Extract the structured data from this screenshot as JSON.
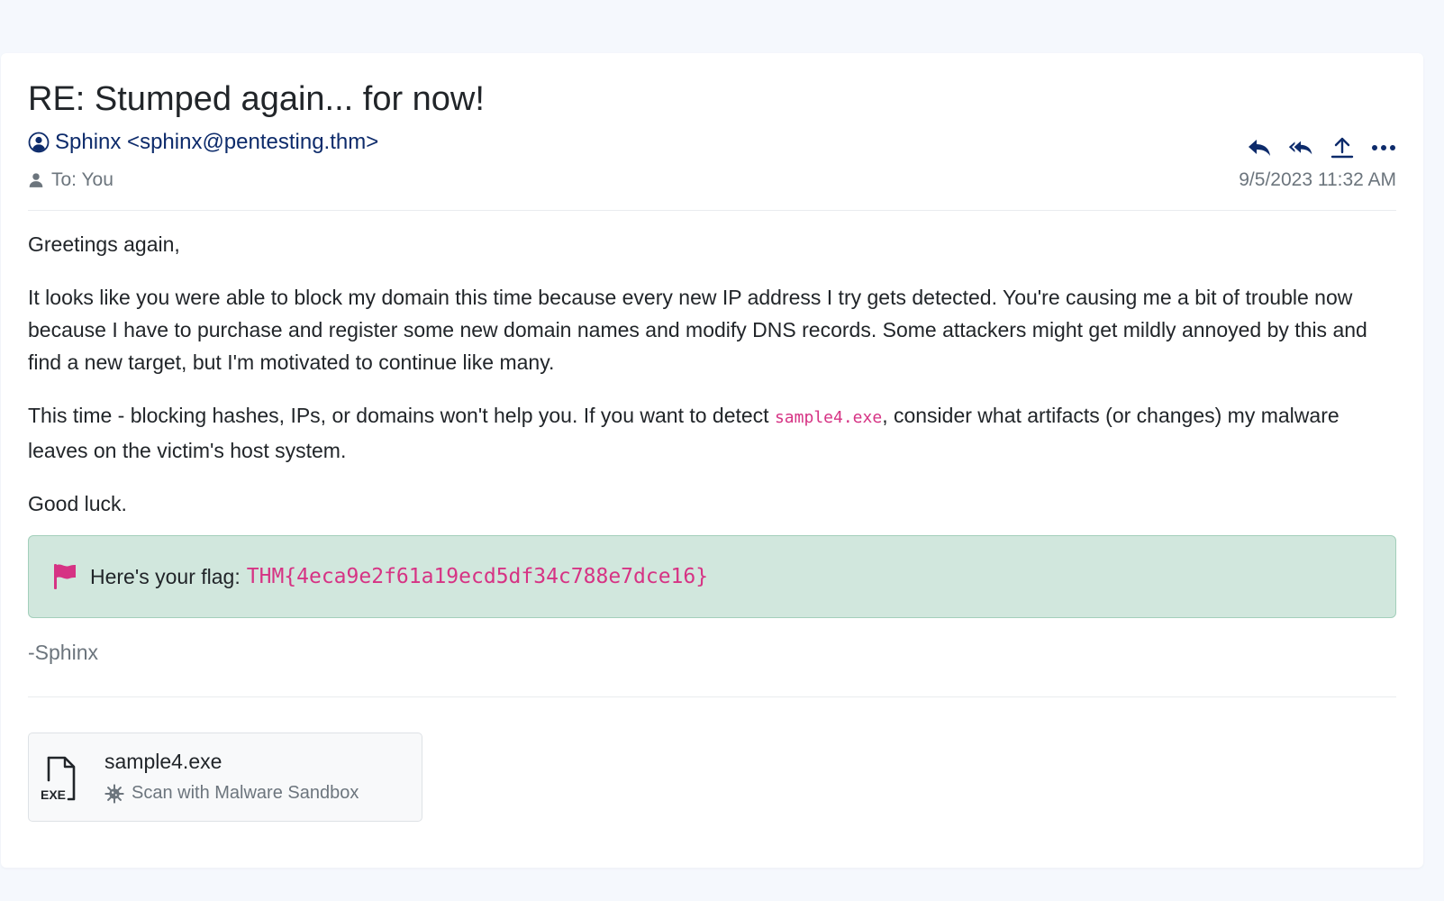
{
  "email": {
    "subject": "RE: Stumped again... for now!",
    "sender": "Sphinx <sphinx@pentesting.thm>",
    "to": "To: You",
    "date": "9/5/2023 11:32 AM",
    "greeting": "Greetings again,",
    "paragraph1": "It looks like you were able to block my domain this time because every new IP address I try gets detected. You're causing me a bit of trouble now because I have to purchase and register some new domain names and modify DNS records. Some attackers might get mildly annoyed by this and find a new target, but I'm motivated to continue like many.",
    "paragraph2_before": "This time - blocking hashes, IPs, or domains won't help you. If you want to detect ",
    "paragraph2_code": "sample4.exe",
    "paragraph2_after": ", consider what artifacts (or changes) my malware leaves on the victim's host system.",
    "closing": "Good luck.",
    "flag_label": "Here's your flag:",
    "flag_value": "THM{4eca9e2f61a19ecd5df34c788e7dce16}",
    "signature": "-Sphinx"
  },
  "actions": {
    "icons": [
      "reply-icon",
      "reply-all-icon",
      "forward-icon",
      "more-icon"
    ]
  },
  "attachment": {
    "file_type_label": "EXE",
    "name": "sample4.exe",
    "scan_label": "Scan with Malware Sandbox"
  },
  "colors": {
    "page_bg": "#f5f8fd",
    "accent": "#0d2b6b",
    "flag_bg": "#d1e7dd",
    "flag_pink": "#d63384",
    "muted": "#6c757d"
  }
}
